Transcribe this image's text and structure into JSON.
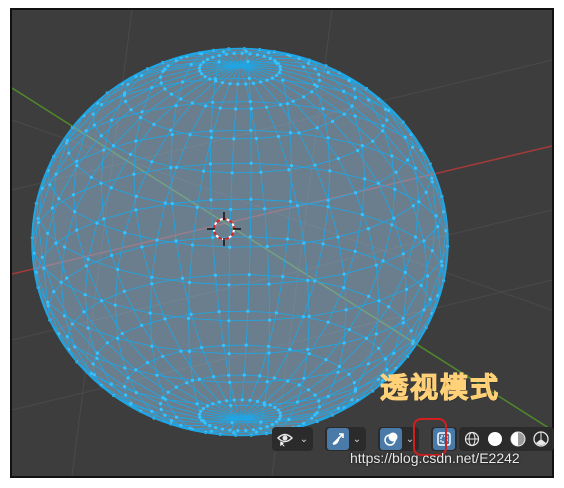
{
  "annotation": {
    "text": "透视模式"
  },
  "toolbar": {
    "buttons": [
      {
        "name": "visibility-selectability-button",
        "icon": "eye-cursor-icon",
        "dropdown": true
      },
      {
        "name": "gizmo-toggle-button",
        "icon": "transform-gizmo-icon",
        "dropdown": true,
        "active": true
      },
      {
        "name": "overlays-toggle-button",
        "icon": "overlays-icon",
        "dropdown": true,
        "active": true
      },
      {
        "name": "xray-toggle-button",
        "icon": "xray-icon",
        "dropdown": false,
        "active": true
      },
      {
        "name": "shading-wireframe-button",
        "icon": "wireframe-sphere-icon",
        "dropdown": false
      },
      {
        "name": "shading-solid-button",
        "icon": "solid-sphere-icon",
        "dropdown": false
      },
      {
        "name": "shading-material-button",
        "icon": "material-sphere-icon",
        "dropdown": false
      },
      {
        "name": "shading-rendered-button",
        "icon": "rendered-sphere-icon",
        "dropdown": false
      }
    ],
    "highlight_color": "#d21f1f"
  },
  "watermark": {
    "text": "https://blog.csdn.net/E2242"
  },
  "colors": {
    "background": "#3d3d3d",
    "wire": "#1ea7e6",
    "vertex": "#39c2ff",
    "x_axis": "#a33a3a",
    "y_axis": "#4f8a2b",
    "annotation": "#f0a030"
  }
}
